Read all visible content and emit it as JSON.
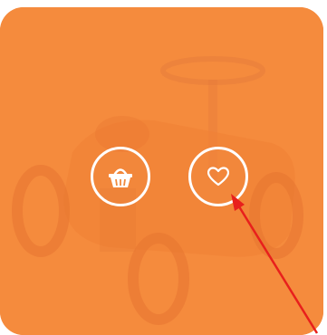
{
  "product_card": {
    "background_color": "#f08a3e",
    "image_subject": "ride-on-toy-car"
  },
  "actions": [
    {
      "icon": "basket-icon",
      "label": ""
    },
    {
      "icon": "heart-icon",
      "label": ""
    }
  ],
  "annotation": {
    "type": "arrow",
    "color": "#e8201c",
    "target": "heart-button"
  }
}
